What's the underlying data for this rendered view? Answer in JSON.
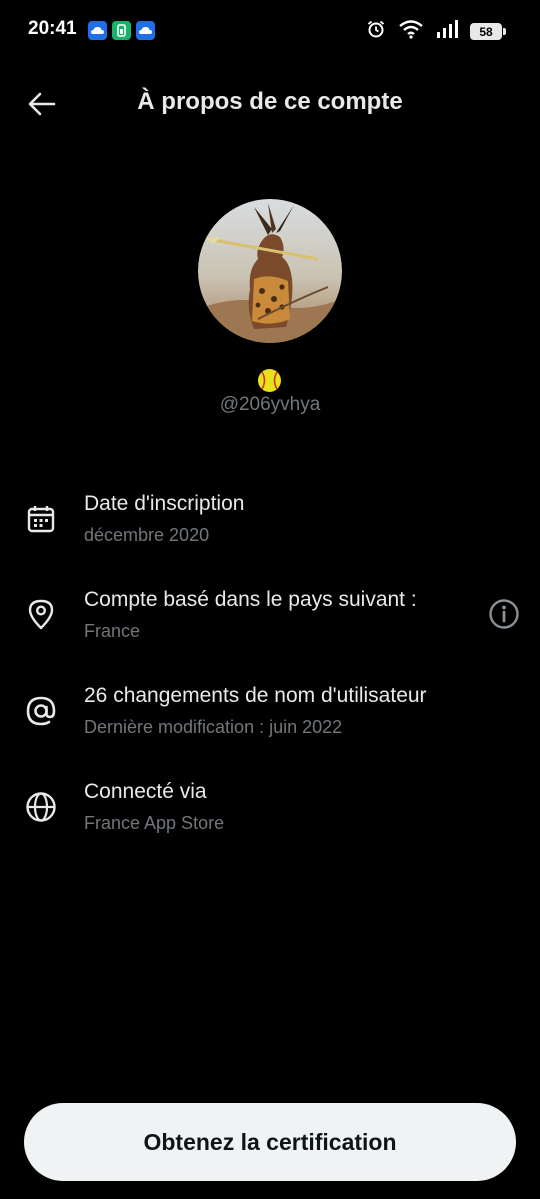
{
  "status_bar": {
    "time": "20:41",
    "battery": "58",
    "notification_icons": [
      "cloud-app-icon",
      "battery-saver-app-icon",
      "cloud-app-icon"
    ],
    "system_icons": [
      "alarm-icon",
      "wifi-icon",
      "signal-icon",
      "battery-icon"
    ]
  },
  "header": {
    "title": "À propos de ce compte",
    "back_icon": "arrow-left-icon"
  },
  "profile": {
    "handle": "@206yvhya",
    "badge_icon": "softball-emoji"
  },
  "info": {
    "joined": {
      "icon": "calendar-icon",
      "title": "Date d'inscription",
      "value": "décembre 2020"
    },
    "country": {
      "icon": "location-pin-icon",
      "title": "Compte basé dans le pays suivant :",
      "value": "France",
      "help_icon": "info-icon"
    },
    "username_changes": {
      "icon": "at-sign-icon",
      "title": "26 changements de nom d'utilisateur",
      "value": "Dernière modification : juin 2022"
    },
    "connected_via": {
      "icon": "globe-icon",
      "title": "Connecté via",
      "value": "France App Store"
    }
  },
  "cta": {
    "label": "Obtenez la certification"
  },
  "colors": {
    "background": "#000000",
    "primary_text": "#e7e9ea",
    "secondary_text": "#71767b",
    "button_bg": "#eff3f4",
    "button_text": "#0f1419"
  }
}
